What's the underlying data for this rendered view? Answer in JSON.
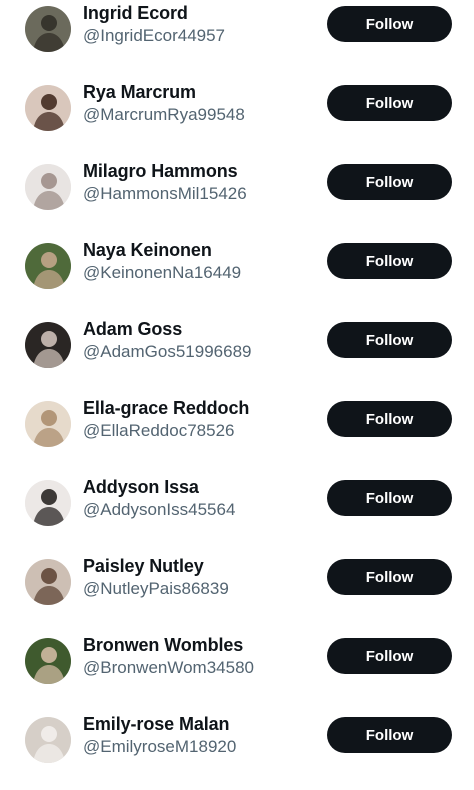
{
  "follow_label": "Follow",
  "users": [
    {
      "name": "Ingrid Ecord",
      "handle": "@IngridEcor44957",
      "avatar_bg": "#6b6a5c",
      "avatar_fg": "#2e2b24"
    },
    {
      "name": "Rya Marcrum",
      "handle": "@MarcrumRya99548",
      "avatar_bg": "#d9c7bc",
      "avatar_fg": "#3a2218"
    },
    {
      "name": "Milagro Hammons",
      "handle": "@HammonsMil15426",
      "avatar_bg": "#e8e4e2",
      "avatar_fg": "#9a8a84"
    },
    {
      "name": "Naya Keinonen",
      "handle": "@KeinonenNa16449",
      "avatar_bg": "#4f6a3a",
      "avatar_fg": "#c9a98f"
    },
    {
      "name": "Adam Goss",
      "handle": "@AdamGos51996689",
      "avatar_bg": "#2a2624",
      "avatar_fg": "#d7c9c1"
    },
    {
      "name": "Ella-grace Reddoch",
      "handle": "@EllaReddoc78526",
      "avatar_bg": "#e6dacb",
      "avatar_fg": "#a88a6a"
    },
    {
      "name": "Addyson Issa",
      "handle": "@AddysonIss45564",
      "avatar_bg": "#ece8e6",
      "avatar_fg": "#1e1a18"
    },
    {
      "name": "Paisley Nutley",
      "handle": "@NutleyPais86839",
      "avatar_bg": "#cdbfb4",
      "avatar_fg": "#5a4030"
    },
    {
      "name": "Bronwen Wombles",
      "handle": "@BronwenWom34580",
      "avatar_bg": "#3f5a2e",
      "avatar_fg": "#d8bfa8"
    },
    {
      "name": "Emily-rose Malan",
      "handle": "@EmilyroseM18920",
      "avatar_bg": "#d6cfc8",
      "avatar_fg": "#f4f1ee"
    }
  ]
}
